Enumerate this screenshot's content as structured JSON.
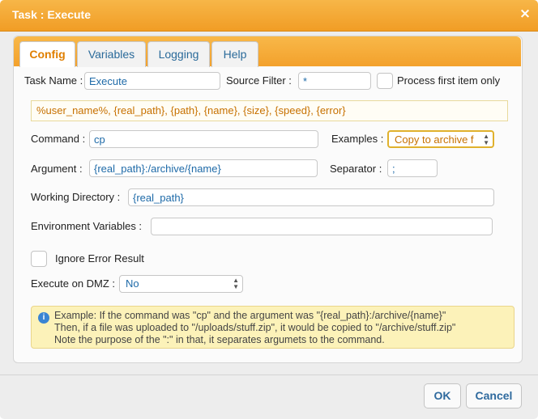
{
  "dialog": {
    "title": "Task : Execute",
    "close_glyph": "×"
  },
  "tabs": [
    {
      "label": "Config",
      "active": true
    },
    {
      "label": "Variables",
      "active": false
    },
    {
      "label": "Logging",
      "active": false
    },
    {
      "label": "Help",
      "active": false
    }
  ],
  "form": {
    "task_name_label": "Task Name :",
    "task_name_value": "Execute",
    "source_filter_label": "Source Filter :",
    "source_filter_value": "*",
    "process_first_label": "Process first item only",
    "variables_hint": "%user_name%, {real_path}, {path}, {name}, {size}, {speed}, {error}",
    "command_label": "Command :",
    "command_value": "cp",
    "examples_label": "Examples :",
    "examples_value": "Copy to archive f",
    "argument_label": "Argument :",
    "argument_value": "{real_path}:/archive/{name}",
    "separator_label": "Separator :",
    "separator_value": ";",
    "working_dir_label": "Working Directory :",
    "working_dir_value": "{real_path}",
    "env_vars_label": "Environment Variables :",
    "env_vars_value": "",
    "ignore_error_label": "Ignore Error Result",
    "dmz_label": "Execute on DMZ :",
    "dmz_value": "No"
  },
  "info": {
    "icon": "info-icon",
    "line1": "Example: If the command was \"cp\" and the argument was \"{real_path}:/archive/{name}\"",
    "line2": "Then, if a file was uploaded to \"/uploads/stuff.zip\", it would be copied to \"/archive/stuff.zip\"",
    "line3": "Note the purpose of the \":\" in that, it separates argumets to the command."
  },
  "buttons": {
    "ok": "OK",
    "cancel": "Cancel"
  },
  "colors": {
    "accent": "#f3a12c",
    "link": "#1e6aa8",
    "active_tab": "#e07f00",
    "info_bg": "#fcf2b9"
  }
}
